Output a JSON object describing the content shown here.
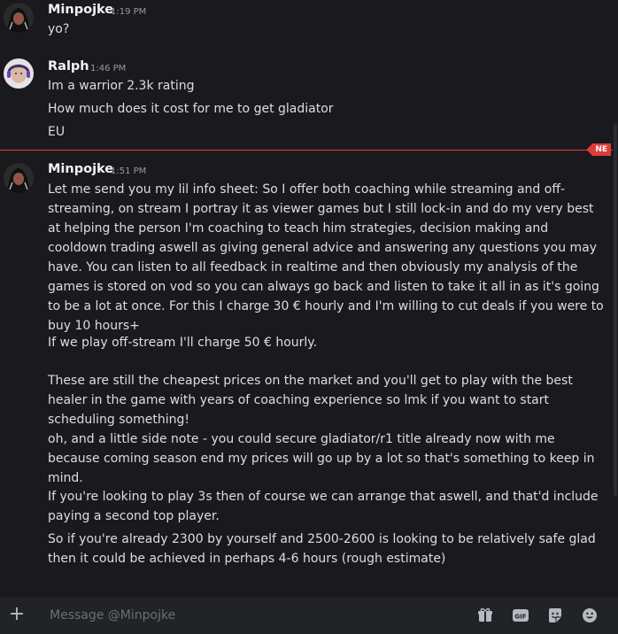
{
  "colors": {
    "background": "#1a1a1e",
    "new_divider": "#e03b3b",
    "username": "#f2f3f5",
    "timestamp": "#949ba4"
  },
  "messages": [
    {
      "username": "Minpojke",
      "timestamp": "1:19 PM",
      "avatar": "dark-hooded-character-avatar",
      "lines": [
        "yo?"
      ]
    },
    {
      "username": "Ralph",
      "timestamp": "1:46 PM",
      "avatar": "bald-man-headset-avatar",
      "lines": [
        "Im a warrior 2.3k rating",
        "How much does it cost for me to get gladiator",
        "EU"
      ]
    },
    {
      "username": "Minpojke",
      "timestamp": "1:51 PM",
      "avatar": "dark-hooded-character-avatar",
      "paragraphs": [
        "Let me send you my lil info sheet: So I offer both coaching while streaming and off-streaming, on stream I portray it as viewer games but I still lock-in and do my very best at helping the person I'm coaching to teach him strategies, decision making and cooldown trading aswell as giving general advice and answering any questions you may have. You can listen to all feedback in realtime and then obviously my analysis of the games is stored on vod so you can always go back and listen to take it all in as it's going to be a lot at once. For this I charge 30 € hourly and I'm willing to cut deals if you were to buy 10 hours+",
        "If we play off-stream I'll charge 50 € hourly.",
        "These are still the cheapest prices on the market and you'll get to play with the best healer in the game with years of coaching experience so lmk if you want to start scheduling something!",
        "oh, and a little side note - you could secure gladiator/r1 title already now with me because coming season end my prices will go up by a lot so that's something to keep in mind.",
        "If you're looking to play 3s then of course we can arrange that aswell, and that'd include paying a second top player.",
        "So if you're already 2300 by yourself and 2500-2600 is looking to be relatively safe glad then it could be achieved in perhaps 4-6 hours (rough estimate)"
      ]
    }
  ],
  "new_badge": "NE",
  "composer": {
    "placeholder": "Message @Minpojke",
    "value": "",
    "icons": [
      "plus-icon",
      "gift-icon",
      "gif-icon",
      "sticker-icon",
      "emoji-icon"
    ],
    "gif_label": "GIF"
  }
}
